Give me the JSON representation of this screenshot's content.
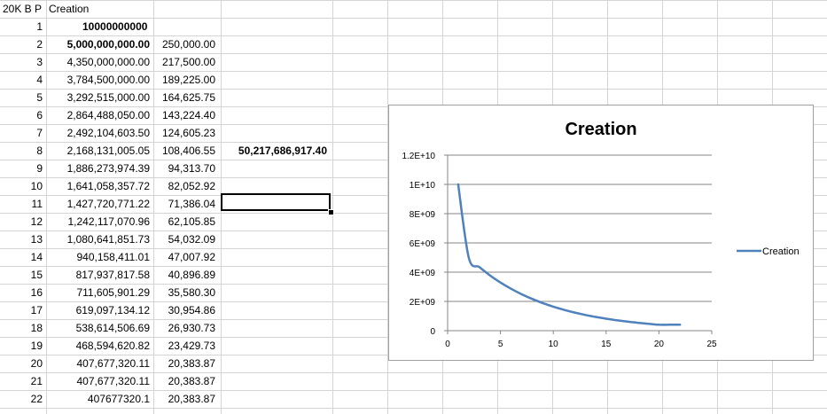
{
  "header": {
    "col_a": "20K B P",
    "col_b": "Creation"
  },
  "rows": [
    {
      "n": "1",
      "b": "10000000000",
      "c": "",
      "d": ""
    },
    {
      "n": "2",
      "b": "5,000,000,000.00",
      "c": "250,000.00",
      "d": ""
    },
    {
      "n": "3",
      "b": "4,350,000,000.00",
      "c": "217,500.00",
      "d": ""
    },
    {
      "n": "4",
      "b": "3,784,500,000.00",
      "c": "189,225.00",
      "d": ""
    },
    {
      "n": "5",
      "b": "3,292,515,000.00",
      "c": "164,625.75",
      "d": ""
    },
    {
      "n": "6",
      "b": "2,864,488,050.00",
      "c": "143,224.40",
      "d": ""
    },
    {
      "n": "7",
      "b": "2,492,104,603.50",
      "c": "124,605.23",
      "d": ""
    },
    {
      "n": "8",
      "b": "2,168,131,005.05",
      "c": "108,406.55",
      "d": "50,217,686,917.40"
    },
    {
      "n": "9",
      "b": "1,886,273,974.39",
      "c": "94,313.70",
      "d": ""
    },
    {
      "n": "10",
      "b": "1,641,058,357.72",
      "c": "82,052.92",
      "d": ""
    },
    {
      "n": "11",
      "b": "1,427,720,771.22",
      "c": "71,386.04",
      "d": ""
    },
    {
      "n": "12",
      "b": "1,242,117,070.96",
      "c": "62,105.85",
      "d": ""
    },
    {
      "n": "13",
      "b": "1,080,641,851.73",
      "c": "54,032.09",
      "d": ""
    },
    {
      "n": "14",
      "b": "940,158,411.01",
      "c": "47,007.92",
      "d": ""
    },
    {
      "n": "15",
      "b": "817,937,817.58",
      "c": "40,896.89",
      "d": ""
    },
    {
      "n": "16",
      "b": "711,605,901.29",
      "c": "35,580.30",
      "d": ""
    },
    {
      "n": "17",
      "b": "619,097,134.12",
      "c": "30,954.86",
      "d": ""
    },
    {
      "n": "18",
      "b": "538,614,506.69",
      "c": "26,930.73",
      "d": ""
    },
    {
      "n": "19",
      "b": "468,594,620.82",
      "c": "23,429.73",
      "d": ""
    },
    {
      "n": "20",
      "b": "407,677,320.11",
      "c": "20,383.87",
      "d": ""
    },
    {
      "n": "21",
      "b": "407,677,320.11",
      "c": "20,383.87",
      "d": ""
    },
    {
      "n": "22",
      "b": "407677320.1",
      "c": "20,383.87",
      "d": ""
    }
  ],
  "chart_data": {
    "type": "line",
    "title": "Creation",
    "xlabel": "",
    "ylabel": "",
    "xlim": [
      0,
      25
    ],
    "ylim": [
      0,
      12000000000
    ],
    "x_ticks": [
      "0",
      "5",
      "10",
      "15",
      "20",
      "25"
    ],
    "y_ticks": [
      "0",
      "2E+09",
      "4E+09",
      "6E+09",
      "8E+09",
      "1E+10",
      "1.2E+10"
    ],
    "legend_position": "right",
    "series": [
      {
        "name": "Creation",
        "color": "#4f81bd",
        "x": [
          1,
          2,
          3,
          4,
          5,
          6,
          7,
          8,
          9,
          10,
          11,
          12,
          13,
          14,
          15,
          16,
          17,
          18,
          19,
          20,
          21,
          22
        ],
        "values": [
          10000000000,
          5000000000,
          4350000000,
          3784500000,
          3292515000,
          2864488050,
          2492104603.5,
          2168131005.05,
          1886273974.39,
          1641058357.72,
          1427720771.22,
          1242117070.96,
          1080641851.73,
          940158411.01,
          817937817.58,
          711605901.29,
          619097134.12,
          538614506.69,
          468594620.82,
          407677320.11,
          407677320.11,
          407677320.1
        ]
      }
    ],
    "grid": true
  }
}
